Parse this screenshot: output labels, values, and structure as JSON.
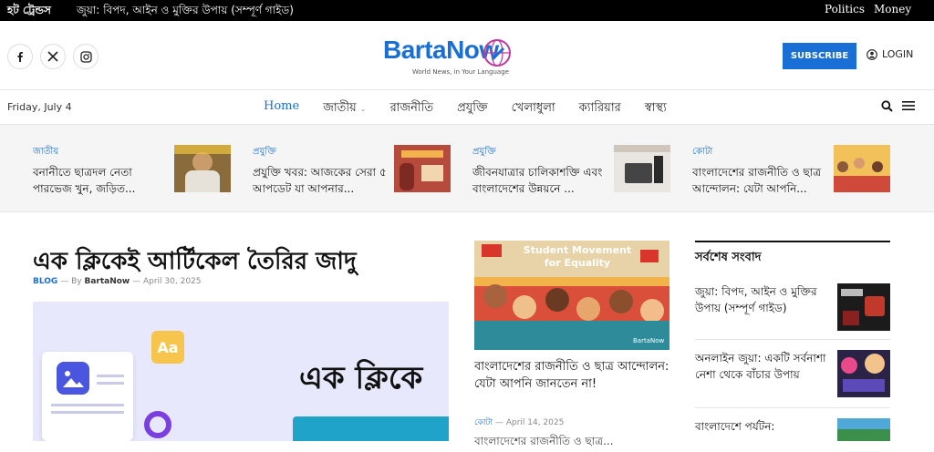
{
  "topbar": {
    "trending_label": "হট ট্রেন্ডস",
    "headline": "জুয়া: বিপদ, আইন ও মুক্তির উপায় (সম্পূর্ণ গাইড)",
    "links": [
      "Politics",
      "Money"
    ]
  },
  "header": {
    "logo_text": "BartaNow",
    "tagline": "World News, in Your Language",
    "subscribe_label": "SUBSCRIBE",
    "login_label": "LOGIN",
    "social_icons": [
      "facebook-icon",
      "x-icon",
      "instagram-icon"
    ]
  },
  "nav": {
    "date": "Friday, July 4",
    "items": [
      "Home",
      "জাতীয়",
      "রাজনীতি",
      "প্রযুক্তি",
      "খেলাধুলা",
      "ক্যারিয়ার",
      "স্বাস্থ্য"
    ]
  },
  "trending": [
    {
      "category": "জাতীয়",
      "title": "বনানীতে ছাত্রদল নেতা পারভেজ খুন, জড়িত..."
    },
    {
      "category": "প্রযুক্তি",
      "title": "প্রযুক্তি খবর: আজকের সেরা ৫ আপডেট যা আপনার..."
    },
    {
      "category": "প্রযুক্তি",
      "title": "জীবনযাত্রার চালিকাশক্তি এবং বাংলাদেশের উন্নয়নে ..."
    },
    {
      "category": "কোটা",
      "title": "বাংলাদেশের রাজনীতি ও ছাত্র আন্দোলন: যেটা আপনি..."
    }
  ],
  "main": {
    "title": "এক ক্লিকেই আর্টিকেল তৈরির জাদু",
    "category": "BLOG",
    "by": "By",
    "author": "BartaNow",
    "date": "April 30, 2025",
    "hero_text_1": "এক ক্লিকে",
    "hero_badge": "Aa"
  },
  "middle": {
    "image_caption": "Student Movement for Equality",
    "image_watermark": "BartaNow",
    "title": "বাংলাদেশের রাজনীতি ও ছাত্র আন্দোলন: যেটা আপনি জানতেন না!",
    "category": "কোটা",
    "date": "April 14, 2025",
    "excerpt": "বাংলাদেশের রাজনীতি ও ছাত্র..."
  },
  "sidebar": {
    "heading": "সর্বশেষ সংবাদ",
    "items": [
      {
        "title": "জুয়া: বিপদ, আইন ও মুক্তির উপায় (সম্পূর্ণ গাইড)"
      },
      {
        "title": "অনলাইন জুয়া: একটি সর্বনাশা নেশা থেকে বাঁচার উপায়"
      },
      {
        "title": "বাংলাদেশে পর্যটন:"
      }
    ]
  },
  "colors": {
    "accent": "#1a6fd6",
    "topbar": "#000000"
  }
}
